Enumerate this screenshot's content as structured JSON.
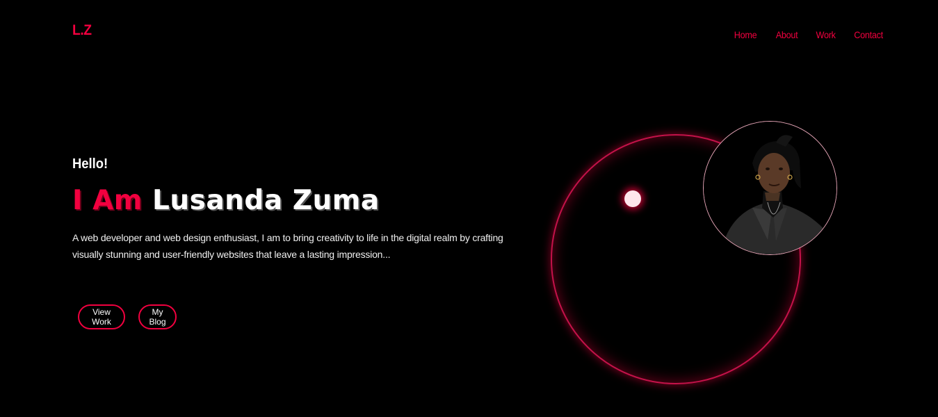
{
  "brand": {
    "logo": "L.Z",
    "accent_color": "#f2003f",
    "background_color": "#000000"
  },
  "nav": {
    "items": [
      {
        "label": "Home"
      },
      {
        "label": "About"
      },
      {
        "label": "Work"
      },
      {
        "label": "Contact"
      }
    ]
  },
  "hero": {
    "greeting": "Hello!",
    "headline_prefix": "I Am",
    "headline_name": "Lusanda Zuma",
    "description": "A web developer and web design enthusiast, I am to bring creativity to life in the digital realm by crafting visually stunning and user-friendly websites that leave a lasting impression...",
    "buttons": {
      "view_work": "View Work",
      "my_blog": "My Blog"
    }
  },
  "visual": {
    "profile_photo": "portrait-photo",
    "ring_color": "#c4124a"
  }
}
